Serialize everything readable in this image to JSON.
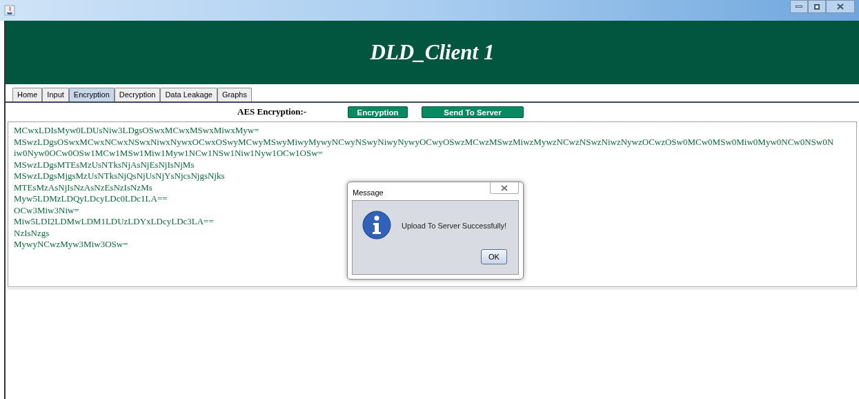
{
  "window": {
    "heading": "DLD_Client 1"
  },
  "tabs": [
    {
      "label": "Home",
      "selected": false
    },
    {
      "label": "Input",
      "selected": false
    },
    {
      "label": "Encryption",
      "selected": true
    },
    {
      "label": "Decryption",
      "selected": false
    },
    {
      "label": "Data Leakage",
      "selected": false
    },
    {
      "label": "Graphs",
      "selected": false
    }
  ],
  "toolbar": {
    "label": "AES Encryption:-",
    "buttons": [
      "Encryption",
      "Send To Server"
    ]
  },
  "output_lines": [
    "MCwxLDIsMyw0LDUsNiw3LDgsOSwxMCwxMSwxMiwxMyw=",
    "MSwzLDgsOSwxMCwxNCwxNSwxNiwxNywxOCwxOSwyMCwyMSwyMiwyMywyNCwyNSwyNiwyNywyOCwyOSwzMCwzMSwzMiwzMywzNCwzNSwzNiwzNywzOCwzOSw0MCw0MSw0Miw0Myw0NCw0NSw0N",
    "iw0Nyw0OCw0OSw1MCw1MSw1Miw1Myw1NCw1NSw1Niw1Nyw1OCw1OSw=",
    "MSwzLDgsMTEsMzUsNTksNjAsNjEsNjIsNjMs",
    "MSwzLDgsMjgsMzUsNTksNjQsNjUsNjYsNjcsNjgsNjks",
    "MTEsMzAsNjIsNzAsNzEsNzIsNzMs",
    "Myw5LDMzLDQyLDcyLDc0LDc1LA==",
    "OCw3Miw3Niw=",
    "Miw5LDI2LDMwLDM1LDUzLDYxLDcyLDc3LA==",
    "NzIsNzgs",
    "MywyNCwzMyw3Miw3OSw="
  ],
  "dialog": {
    "title": "Message",
    "message": "Upload To Server Successfully!",
    "button": "OK"
  }
}
